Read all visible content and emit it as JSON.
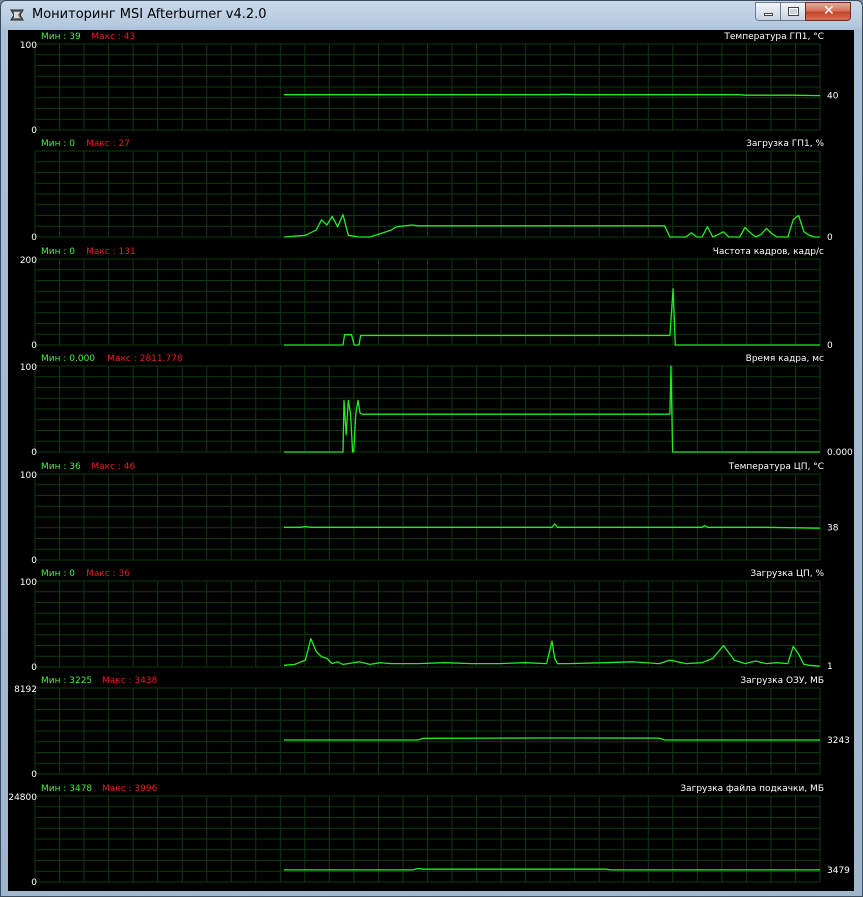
{
  "window": {
    "title": "Мониторинг MSI Afterburner v4.2.0"
  },
  "colors": {
    "grid": "#0e3a0e",
    "line": "#22ee22",
    "min": "#44ee44",
    "max": "#e02020",
    "text": "#ffffff",
    "background": "#000000"
  },
  "icons": {
    "app": "afterburner-icon",
    "minimize": "minimize-icon",
    "maximize": "maximize-icon",
    "close": "close-icon"
  },
  "chart_data": [
    {
      "type": "line",
      "title": "Температура ГП1, °С",
      "min_label": "Мин : 39",
      "max_label": "Макс : 43",
      "ylim": [
        0,
        100
      ],
      "y_top_label": "100",
      "y_bottom_label": "0",
      "current_value_label": "40",
      "current_value": 40,
      "x": [
        0,
        35,
        51,
        52,
        55,
        57,
        58,
        70,
        80,
        85,
        86,
        95,
        100
      ],
      "y": [
        41,
        41,
        41,
        41.5,
        41,
        41,
        41,
        41,
        41,
        41,
        40.5,
        40.5,
        40
      ]
    },
    {
      "type": "line",
      "title": "Загрузка ГП1, %",
      "min_label": "Мин : 0",
      "max_label": "Макс : 27",
      "ylim": [
        0,
        100
      ],
      "y_top_label": "",
      "y_bottom_label": "0",
      "current_value_label": "0",
      "current_value": 0,
      "x": [
        0,
        4,
        6,
        7,
        8,
        9,
        10,
        11,
        12,
        13,
        14,
        16,
        20,
        21,
        24,
        25,
        28,
        30,
        40,
        50,
        60,
        71,
        72,
        73,
        75,
        76,
        77,
        78,
        79,
        80,
        81,
        82,
        83,
        84,
        85,
        86,
        87,
        88,
        89,
        90,
        91,
        92,
        93,
        94,
        95,
        96,
        97,
        98,
        99,
        100
      ],
      "y": [
        0,
        2,
        8,
        20,
        14,
        24,
        12,
        26,
        2,
        1,
        0,
        0,
        8,
        12,
        14,
        13,
        13,
        13,
        13,
        13,
        13,
        13,
        0,
        0,
        0,
        5,
        0,
        0,
        12,
        0,
        3,
        6,
        0,
        0,
        0,
        11,
        5,
        0,
        3,
        10,
        4,
        0,
        0,
        0,
        20,
        25,
        6,
        2,
        0,
        0
      ]
    },
    {
      "type": "line",
      "title": "Частота кадров, кадр/с",
      "min_label": "Мин : 0",
      "max_label": "Макс : 131",
      "ylim": [
        0,
        200
      ],
      "y_top_label": "200",
      "y_bottom_label": "0",
      "current_value_label": "0",
      "current_value": 0,
      "x": [
        0,
        11,
        11.3,
        12.6,
        13.1,
        14,
        14.3,
        25,
        40,
        60,
        72,
        72.6,
        73,
        73.5,
        100
      ],
      "y": [
        0,
        0,
        24,
        24,
        0,
        0,
        22,
        22,
        22,
        22,
        22,
        131,
        0,
        0,
        0
      ]
    },
    {
      "type": "line",
      "title": "Время кадра, мс",
      "min_label": "Мин : 0.000",
      "max_label": "Макс : 2811.778",
      "ylim": [
        0,
        100
      ],
      "y_top_label": "100",
      "y_bottom_label": "0",
      "current_value_label": "0.000",
      "current_value": 0,
      "x": [
        0,
        11,
        11.2,
        11.6,
        12,
        12.4,
        12.8,
        13,
        13.4,
        13.8,
        14.2,
        14.6,
        15,
        30,
        50,
        72,
        72.2,
        72.5,
        72.8,
        100
      ],
      "y": [
        0,
        0,
        60,
        20,
        60,
        45,
        0,
        0,
        45,
        60,
        45,
        44,
        44,
        44,
        44,
        44,
        100,
        0,
        0,
        0
      ]
    },
    {
      "type": "line",
      "title": "Температура ЦП, °С",
      "min_label": "Мин : 36",
      "max_label": "Макс : 46",
      "ylim": [
        0,
        100
      ],
      "y_top_label": "100",
      "y_bottom_label": "0",
      "current_value_label": "38",
      "current_value": 38,
      "x": [
        0,
        3,
        4,
        5,
        20,
        30,
        40,
        50,
        50.5,
        51,
        60,
        70,
        78,
        78.5,
        79,
        90,
        100
      ],
      "y": [
        38,
        38,
        39,
        38,
        38,
        38,
        38,
        38,
        42,
        38,
        38,
        38,
        38,
        40,
        38,
        38,
        37
      ]
    },
    {
      "type": "line",
      "title": "Загрузка ЦП, %",
      "min_label": "Мин : 0",
      "max_label": "Макс : 36",
      "ylim": [
        0,
        100
      ],
      "y_top_label": "100",
      "y_bottom_label": "0",
      "current_value_label": "1",
      "current_value": 1,
      "x": [
        0,
        2,
        4,
        5,
        6,
        7,
        8,
        9,
        10,
        11,
        12,
        14,
        16,
        18,
        20,
        25,
        30,
        35,
        40,
        45,
        49,
        50,
        50.5,
        51,
        53,
        60,
        65,
        70,
        72,
        75,
        78,
        80,
        82,
        84,
        86,
        88,
        90,
        92,
        94,
        95,
        96,
        97,
        98,
        100
      ],
      "y": [
        2,
        3,
        8,
        33,
        18,
        12,
        10,
        4,
        6,
        3,
        4,
        6,
        3,
        5,
        4,
        4,
        5,
        4,
        4,
        5,
        4,
        30,
        10,
        4,
        4,
        5,
        6,
        4,
        8,
        4,
        5,
        10,
        25,
        8,
        4,
        7,
        4,
        5,
        4,
        24,
        15,
        3,
        2,
        1
      ]
    },
    {
      "type": "line",
      "title": "Загрузка ОЗУ, МБ",
      "min_label": "Мин : 3225",
      "max_label": "Макс : 3438",
      "ylim": [
        0,
        8192
      ],
      "y_top_label": "8192",
      "y_bottom_label": "0",
      "current_value_label": "3243",
      "current_value": 3243,
      "x": [
        0,
        25,
        26,
        40,
        50,
        70,
        71,
        100
      ],
      "y": [
        3243,
        3243,
        3400,
        3420,
        3430,
        3420,
        3243,
        3243
      ]
    },
    {
      "type": "line",
      "title": "Загрузка файла подкачки, МБ",
      "min_label": "Мин : 3478",
      "max_label": "Макс : 3996",
      "ylim": [
        0,
        24800
      ],
      "y_top_label": "24800",
      "y_bottom_label": "0",
      "current_value_label": "3479",
      "current_value": 3479,
      "x": [
        0,
        24,
        25,
        26,
        30,
        60,
        61,
        100
      ],
      "y": [
        3478,
        3478,
        3900,
        3700,
        3700,
        3700,
        3479,
        3479
      ]
    }
  ]
}
